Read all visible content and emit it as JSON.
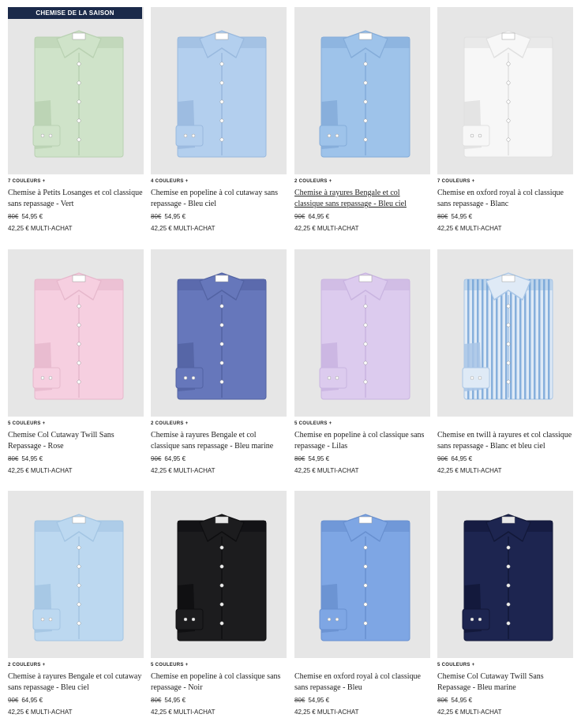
{
  "badge_label": "CHEMISE DE LA SAISON",
  "products": [
    {
      "colors_label": "7 COULEURS +",
      "title": "Chemise à Petits Losanges et col classique sans repassage - Vert",
      "old_price": "80€",
      "price": "54,95 €",
      "multi": "42,25 € MULTI-ACHAT",
      "shirt_color": "#cfe3c9",
      "shirt_shade": "#b9d1b2",
      "underlined": false
    },
    {
      "colors_label": "4 COULEURS +",
      "title": "Chemise en popeline à col cutaway sans repassage - Bleu ciel",
      "old_price": "80€",
      "price": "54,95 €",
      "multi": "42,25 € MULTI-ACHAT",
      "shirt_color": "#b3cfee",
      "shirt_shade": "#99b9de",
      "underlined": false
    },
    {
      "colors_label": "2 COULEURS +",
      "title": "Chemise à rayures Bengale et col classique sans repassage - Bleu ciel",
      "old_price": "90€",
      "price": "64,95 €",
      "multi": "42,25 € MULTI-ACHAT",
      "shirt_color": "#9ec3ea",
      "shirt_shade": "#84acd9",
      "underlined": true
    },
    {
      "colors_label": "7 COULEURS +",
      "title": "Chemise en oxford royal à col classique sans repassage - Blanc",
      "old_price": "80€",
      "price": "54,95 €",
      "multi": "42,25 € MULTI-ACHAT",
      "shirt_color": "#f7f7f7",
      "shirt_shade": "#e0e0e0",
      "underlined": false
    },
    {
      "colors_label": "5 COULEURS +",
      "title": "Chemise Col Cutaway Twill Sans Repassage - Rose",
      "old_price": "80€",
      "price": "54,95 €",
      "multi": "42,25 € MULTI-ACHAT",
      "shirt_color": "#f6cfe0",
      "shirt_shade": "#e6b8cc",
      "underlined": false
    },
    {
      "colors_label": "2 COULEURS +",
      "title": "Chemise à rayures Bengale et col classique sans repassage - Bleu marine",
      "old_price": "90€",
      "price": "64,95 €",
      "multi": "42,25 € MULTI-ACHAT",
      "shirt_color": "#6677bb",
      "shirt_shade": "#5363a3",
      "underlined": false
    },
    {
      "colors_label": "5 COULEURS +",
      "title": "Chemise en popeline à col classique sans repassage - Lilas",
      "old_price": "80€",
      "price": "54,95 €",
      "multi": "42,25 € MULTI-ACHAT",
      "shirt_color": "#dccbee",
      "shirt_shade": "#c9b4e0",
      "underlined": false
    },
    {
      "colors_label": "",
      "title": "Chemise en twill à rayures et col classique sans repassage - Blanc et bleu ciel",
      "old_price": "90€",
      "price": "64,95 €",
      "multi": "42,25 € MULTI-ACHAT",
      "shirt_color": "#dfeaf6",
      "shirt_shade": "#a9c6e6",
      "underlined": false
    },
    {
      "colors_label": "2 COULEURS +",
      "title": "Chemise à rayures Bengale et col cutaway sans repassage - Bleu ciel",
      "old_price": "90€",
      "price": "64,95 €",
      "multi": "42,25 € MULTI-ACHAT",
      "shirt_color": "#bcd8f0",
      "shirt_shade": "#a3c5e3",
      "underlined": false
    },
    {
      "colors_label": "5 COULEURS +",
      "title": "Chemise en popeline à col classique sans repassage - Noir",
      "old_price": "80€",
      "price": "54,95 €",
      "multi": "42,25 € MULTI-ACHAT",
      "shirt_color": "#1c1c1e",
      "shirt_shade": "#0e0e10",
      "underlined": false
    },
    {
      "colors_label": "",
      "title": "Chemise en oxford royal à col classique sans repassage - Bleu",
      "old_price": "80€",
      "price": "54,95 €",
      "multi": "42,25 € MULTI-ACHAT",
      "shirt_color": "#7ea6e4",
      "shirt_shade": "#6890d0",
      "underlined": false
    },
    {
      "colors_label": "5 COULEURS +",
      "title": "Chemise Col Cutaway Twill Sans Repassage - Bleu marine",
      "old_price": "80€",
      "price": "54,95 €",
      "multi": "42,25 € MULTI-ACHAT",
      "shirt_color": "#1d2550",
      "shirt_shade": "#121838",
      "underlined": false
    }
  ]
}
